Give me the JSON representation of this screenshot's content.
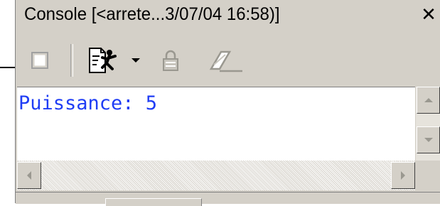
{
  "editor": {
    "brace": "}"
  },
  "console_view": {
    "title": "Console [<arrete...3/07/04 16:58)]",
    "close_glyph": "✕",
    "output_line": "Puissance: 5"
  },
  "toolbar": {
    "buttons": [
      {
        "icon": "terminate-icon",
        "state": "disabled"
      },
      {
        "icon": "display-selected-console-icon",
        "state": "enabled"
      },
      {
        "icon": "dropdown-arrow-icon",
        "state": "enabled"
      },
      {
        "icon": "scroll-lock-icon",
        "state": "disabled"
      },
      {
        "icon": "clear-console-icon",
        "state": "disabled"
      }
    ]
  },
  "colors": {
    "panel_bg": "#d4d0c8",
    "console_text": "#1f3df5",
    "console_bg": "#ffffff"
  }
}
